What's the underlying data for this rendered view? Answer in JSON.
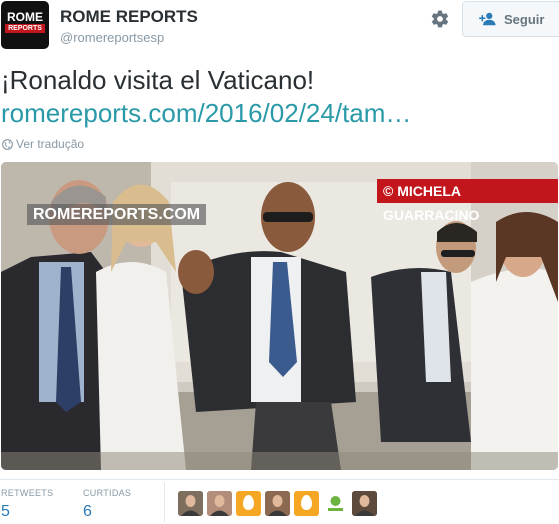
{
  "account": {
    "display_name": "ROME REPORTS",
    "screen_name": "@romereportsesp",
    "avatar_logo_top": "ROME",
    "avatar_logo_bar": "REPORTS"
  },
  "actions": {
    "follow_label": "Seguir"
  },
  "tweet": {
    "text": "¡Ronaldo visita el Vaticano!",
    "link": "romereports.com/2016/02/24/tam…",
    "translate_label": "Ver tradução"
  },
  "photo": {
    "watermark_left": "ROMEREPORTS.COM",
    "watermark_right": "© MICHELA GUARRACINO"
  },
  "stats": {
    "retweets_label": "RETWEETS",
    "retweets_value": "5",
    "likes_label": "CURTIDAS",
    "likes_value": "6"
  },
  "likers": [
    {
      "type": "photo",
      "color": "#7d6e5e"
    },
    {
      "type": "photo",
      "color": "#b48c7a"
    },
    {
      "type": "egg",
      "color": "#f5a623"
    },
    {
      "type": "photo",
      "color": "#8c6a52"
    },
    {
      "type": "egg",
      "color": "#f5a623"
    },
    {
      "type": "logo",
      "color": "#e9efe4"
    },
    {
      "type": "photo",
      "color": "#5e4a3c"
    }
  ],
  "colors": {
    "link": "#2a99a8",
    "stat_value": "#2a79b5",
    "muted": "#8899a6",
    "brand_red": "#c3151c"
  }
}
